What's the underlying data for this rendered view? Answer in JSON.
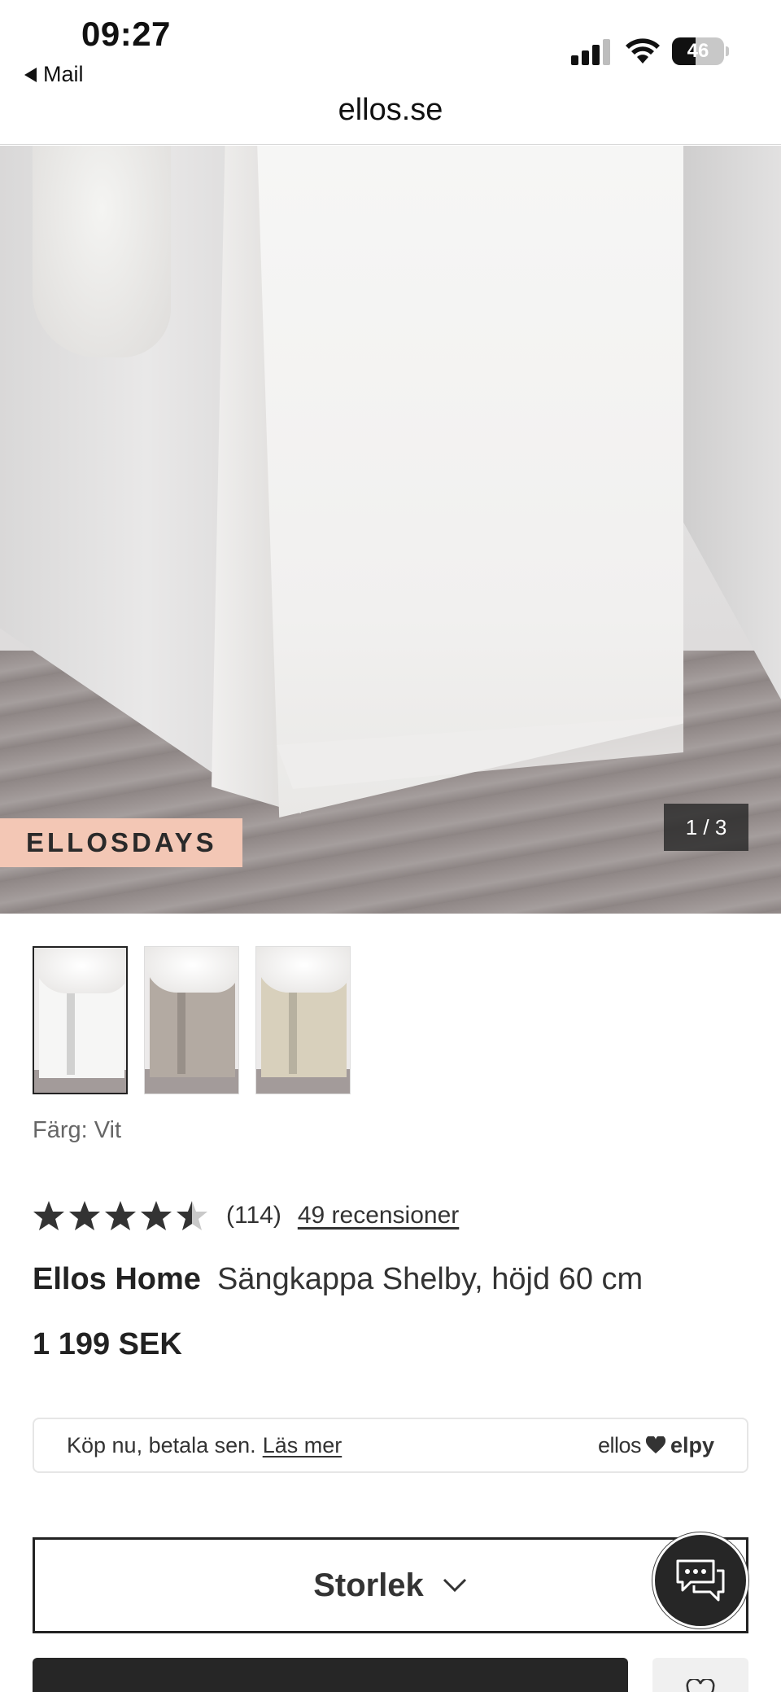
{
  "status_bar": {
    "time": "09:27",
    "back_label": "Mail",
    "battery_level": "46",
    "battery_fraction": 0.46
  },
  "browser": {
    "url": "ellos.se"
  },
  "hero": {
    "badge": "ELLOSDAYS",
    "counter": "1 / 3"
  },
  "thumbnails": [
    {
      "color": "#f6f6f5",
      "selected": true
    },
    {
      "color": "#b3aaa2",
      "selected": false
    },
    {
      "color": "#d8d0bc",
      "selected": false
    }
  ],
  "color_label": "Färg: Vit",
  "rating": {
    "value": 4.5,
    "max": 5,
    "count": "(114)",
    "reviews_link": "49 recensioner"
  },
  "product": {
    "brand": "Ellos Home",
    "name": "Sängkappa Shelby, höjd 60 cm",
    "price": "1 199 SEK"
  },
  "payment": {
    "text": "Köp nu, betala sen.",
    "link": "Läs mer",
    "brand_left": "ellos",
    "brand_right": "elpy"
  },
  "size_selector": {
    "label": "Storlek"
  },
  "icons": {
    "back": "back-triangle-icon",
    "signal": "cellular-signal-icon",
    "wifi": "wifi-icon",
    "battery": "battery-icon",
    "chat": "chat-bubble-icon",
    "chevron": "chevron-down-icon",
    "heart": "heart-icon"
  },
  "colors": {
    "badge_bg": "#f3c7b5",
    "dark": "#262626"
  }
}
